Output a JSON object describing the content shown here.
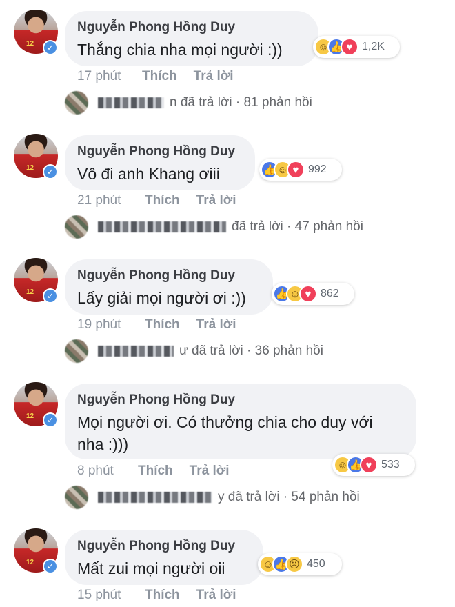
{
  "comments": [
    {
      "author": "Nguyễn Phong Hồng Duy",
      "text": "Thắng chia nha mọi người :))",
      "reactions": [
        "haha",
        "like",
        "love"
      ],
      "reaction_count": "1,2K",
      "time": "17 phút",
      "like_label": "Thích",
      "reply_label": "Trả lời",
      "reply_summary_tail": "n đã trả lời · 81 phản hồi"
    },
    {
      "author": "Nguyễn Phong Hồng Duy",
      "text": "Vô đi anh Khang ơiii",
      "reactions": [
        "like",
        "haha",
        "love"
      ],
      "reaction_count": "992",
      "time": "21 phút",
      "like_label": "Thích",
      "reply_label": "Trả lời",
      "reply_summary_tail": "đã trả lời · 47 phản hồi"
    },
    {
      "author": "Nguyễn Phong Hồng Duy",
      "text": "Lấy giải mọi người ơi :))",
      "reactions": [
        "like",
        "haha",
        "love"
      ],
      "reaction_count": "862",
      "time": "19 phút",
      "like_label": "Thích",
      "reply_label": "Trả lời",
      "reply_summary_tail": "ư đã trả lời · 36 phản hồi"
    },
    {
      "author": "Nguyễn Phong Hồng Duy",
      "text": "Mọi người ơi. Có thưởng chia cho duy với nha :)))",
      "reactions": [
        "haha",
        "like",
        "love"
      ],
      "reaction_count": "533",
      "time": "8 phút",
      "like_label": "Thích",
      "reply_label": "Trả lời",
      "reply_summary_tail": "y đã trả lời · 54 phản hồi"
    },
    {
      "author": "Nguyễn Phong Hồng Duy",
      "text": "Mất zui mọi người oii",
      "reactions": [
        "haha",
        "like",
        "sad"
      ],
      "reaction_count": "450",
      "time": "15 phút",
      "like_label": "Thích",
      "reply_label": "Trả lời"
    }
  ],
  "reaction_glyphs": {
    "like": "👍",
    "love": "♥",
    "haha": "☺",
    "sad": "☹"
  },
  "icons": {
    "verified": "check-badge-icon"
  },
  "colors": {
    "verified_blue": "#4a90e2",
    "bubble_bg": "#f1f2f5",
    "like_blue": "#4a78e8",
    "love_red": "#f0405a"
  }
}
